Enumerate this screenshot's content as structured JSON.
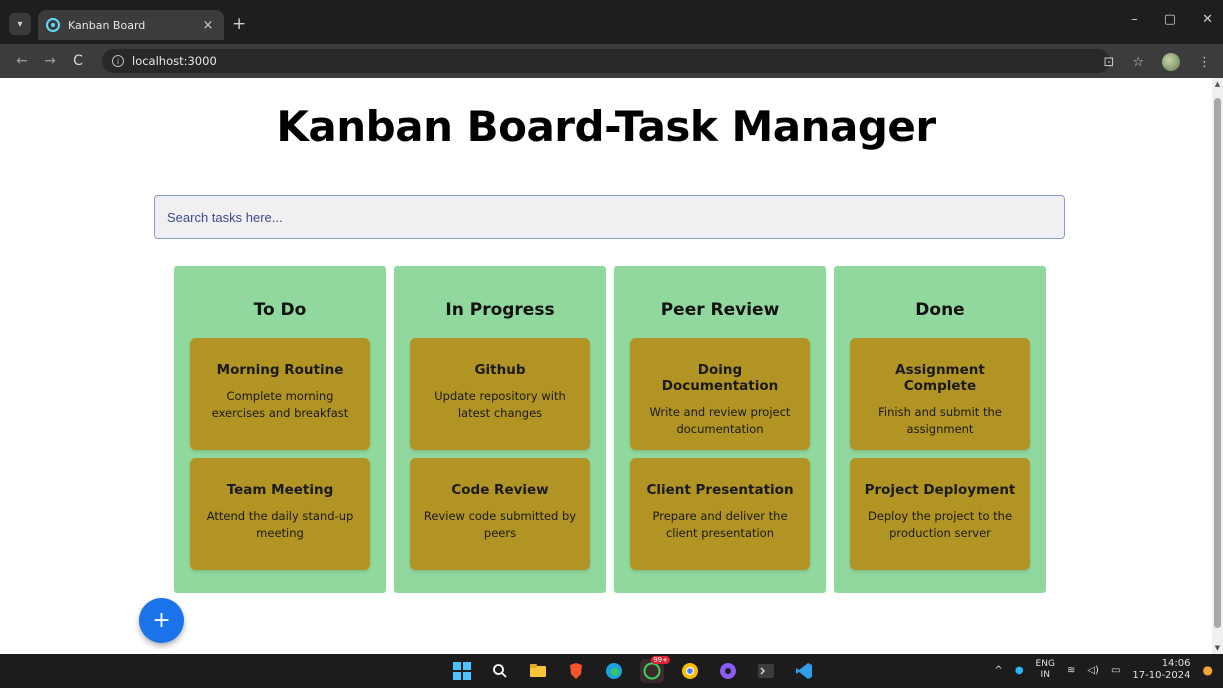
{
  "browser": {
    "tab_title": "Kanban Board",
    "tab_close": "×",
    "new_tab": "+",
    "url": "localhost:3000",
    "back": "←",
    "forward": "→",
    "reload": "C",
    "info": "i",
    "window_controls": {
      "minimize": "–",
      "restore": "▢",
      "close": "✕"
    },
    "bookmark": "☆",
    "install": "⊡",
    "menu": "⋮"
  },
  "page": {
    "title": "Kanban Board-Task Manager",
    "search_placeholder": "Search tasks here...",
    "fab_label": "+"
  },
  "columns": [
    {
      "title": "To Do",
      "cards": [
        {
          "title": "Morning Routine",
          "desc": "Complete morning exercises and breakfast"
        },
        {
          "title": "Team Meeting",
          "desc": "Attend the daily stand-up meeting"
        }
      ]
    },
    {
      "title": "In Progress",
      "cards": [
        {
          "title": "Github",
          "desc": "Update repository with latest changes"
        },
        {
          "title": "Code Review",
          "desc": "Review code submitted by peers"
        }
      ]
    },
    {
      "title": "Peer Review",
      "cards": [
        {
          "title": "Doing Documentation",
          "desc": "Write and review project documentation"
        },
        {
          "title": "Client Presentation",
          "desc": "Prepare and deliver the client presentation"
        }
      ]
    },
    {
      "title": "Done",
      "cards": [
        {
          "title": "Assignment Complete",
          "desc": "Finish and submit the assignment"
        },
        {
          "title": "Project Deployment",
          "desc": "Deploy the project to the production server"
        }
      ]
    }
  ],
  "taskbar": {
    "whatsapp_badge": "99+",
    "lang_top": "ENG",
    "lang_bottom": "IN",
    "time": "14:06",
    "date": "17-10-2024"
  },
  "colors": {
    "column_bg": "#90d89e",
    "card_bg": "#b19424",
    "fab_bg": "#1a73e8"
  }
}
